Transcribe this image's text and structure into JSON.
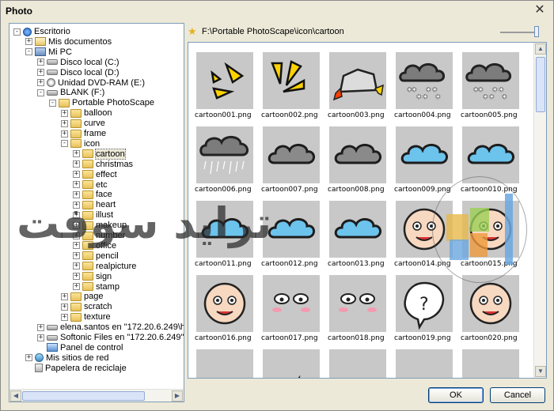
{
  "window": {
    "title": "Photo",
    "close": "✕"
  },
  "tree": [
    {
      "label": "Escritorio",
      "level": 0,
      "exp": "−",
      "icon": "desktop"
    },
    {
      "label": "Mis documentos",
      "level": 1,
      "exp": "+",
      "icon": "documents"
    },
    {
      "label": "Mi PC",
      "level": 1,
      "exp": "−",
      "icon": "computer"
    },
    {
      "label": "Disco local (C:)",
      "level": 2,
      "exp": "+",
      "icon": "drive"
    },
    {
      "label": "Disco local (D:)",
      "level": 2,
      "exp": "+",
      "icon": "drive"
    },
    {
      "label": "Unidad DVD-RAM (E:)",
      "level": 2,
      "exp": "+",
      "icon": "dvd"
    },
    {
      "label": "BLANK (F:)",
      "level": 2,
      "exp": "−",
      "icon": "drive"
    },
    {
      "label": "Portable PhotoScape",
      "level": 3,
      "exp": "−",
      "icon": "folder"
    },
    {
      "label": "balloon",
      "level": 4,
      "exp": "+",
      "icon": "folder"
    },
    {
      "label": "curve",
      "level": 4,
      "exp": "+",
      "icon": "folder"
    },
    {
      "label": "frame",
      "level": 4,
      "exp": "+",
      "icon": "folder"
    },
    {
      "label": "icon",
      "level": 4,
      "exp": "−",
      "icon": "folder"
    },
    {
      "label": "cartoon",
      "level": 5,
      "exp": "+",
      "icon": "folder",
      "selected": true
    },
    {
      "label": "christmas",
      "level": 5,
      "exp": "+",
      "icon": "folder"
    },
    {
      "label": "effect",
      "level": 5,
      "exp": "+",
      "icon": "folder"
    },
    {
      "label": "etc",
      "level": 5,
      "exp": "+",
      "icon": "folder"
    },
    {
      "label": "face",
      "level": 5,
      "exp": "+",
      "icon": "folder"
    },
    {
      "label": "heart",
      "level": 5,
      "exp": "+",
      "icon": "folder"
    },
    {
      "label": "illust",
      "level": 5,
      "exp": "+",
      "icon": "folder"
    },
    {
      "label": "makeup",
      "level": 5,
      "exp": "+",
      "icon": "folder"
    },
    {
      "label": "number",
      "level": 5,
      "exp": "+",
      "icon": "folder"
    },
    {
      "label": "office",
      "level": 5,
      "exp": "+",
      "icon": "folder"
    },
    {
      "label": "pencil",
      "level": 5,
      "exp": "+",
      "icon": "folder"
    },
    {
      "label": "realpicture",
      "level": 5,
      "exp": "+",
      "icon": "folder"
    },
    {
      "label": "sign",
      "level": 5,
      "exp": "+",
      "icon": "folder"
    },
    {
      "label": "stamp",
      "level": 5,
      "exp": "+",
      "icon": "folder"
    },
    {
      "label": "page",
      "level": 4,
      "exp": "+",
      "icon": "folder"
    },
    {
      "label": "scratch",
      "level": 4,
      "exp": "+",
      "icon": "folder"
    },
    {
      "label": "texture",
      "level": 4,
      "exp": "+",
      "icon": "folder"
    },
    {
      "label": "elena.santos en \"172.20.6.249\\hom",
      "level": 2,
      "exp": "+",
      "icon": "drive"
    },
    {
      "label": "Softonic Files en \"172.20.6.249\" (Z",
      "level": 2,
      "exp": "+",
      "icon": "drive"
    },
    {
      "label": "Panel de control",
      "level": 2,
      "exp": "",
      "icon": "control"
    },
    {
      "label": "Mis sitios de red",
      "level": 1,
      "exp": "+",
      "icon": "network"
    },
    {
      "label": "Papelera de reciclaje",
      "level": 1,
      "exp": "",
      "icon": "recycle"
    }
  ],
  "path": {
    "text": "F:\\Portable PhotoScape\\icon\\cartoon"
  },
  "zoom": {
    "level": 0.95
  },
  "thumbnails": [
    {
      "name": "cartoon001.png",
      "kind": "yellow2"
    },
    {
      "name": "cartoon002.png",
      "kind": "yellow3"
    },
    {
      "name": "cartoon003.png",
      "kind": "rock"
    },
    {
      "name": "cartoon004.png",
      "kind": "snowcloud"
    },
    {
      "name": "cartoon005.png",
      "kind": "snowcloud"
    },
    {
      "name": "cartoon006.png",
      "kind": "raincloud"
    },
    {
      "name": "cartoon007.png",
      "kind": "graycloud"
    },
    {
      "name": "cartoon008.png",
      "kind": "graycloud"
    },
    {
      "name": "cartoon009.png",
      "kind": "bluecloud"
    },
    {
      "name": "cartoon010.png",
      "kind": "bluecloud"
    },
    {
      "name": "cartoon011.png",
      "kind": "bluecloud"
    },
    {
      "name": "cartoon012.png",
      "kind": "bluecloud"
    },
    {
      "name": "cartoon013.png",
      "kind": "bluecloud"
    },
    {
      "name": "cartoon014.png",
      "kind": "face"
    },
    {
      "name": "cartoon015.png",
      "kind": "face"
    },
    {
      "name": "cartoon016.png",
      "kind": "face"
    },
    {
      "name": "cartoon017.png",
      "kind": "eyes"
    },
    {
      "name": "cartoon018.png",
      "kind": "eyes"
    },
    {
      "name": "cartoon019.png",
      "kind": "question"
    },
    {
      "name": "cartoon020.png",
      "kind": "face"
    },
    {
      "name": "",
      "kind": "fire"
    },
    {
      "name": "",
      "kind": "splash"
    },
    {
      "name": "",
      "kind": "scribble"
    },
    {
      "name": "",
      "kind": "spiral"
    },
    {
      "name": "",
      "kind": "lines"
    }
  ],
  "buttons": {
    "ok": "OK",
    "cancel": "Cancel"
  },
  "watermark": {
    "text": "ترايد سوفت"
  },
  "colors": {
    "accent": "#003c74",
    "thumb_bg": "#c8c8c8",
    "cloud_blue": "#6cc3ec",
    "cloud_gray": "#7c7c7c",
    "yellow": "#ffd200"
  }
}
